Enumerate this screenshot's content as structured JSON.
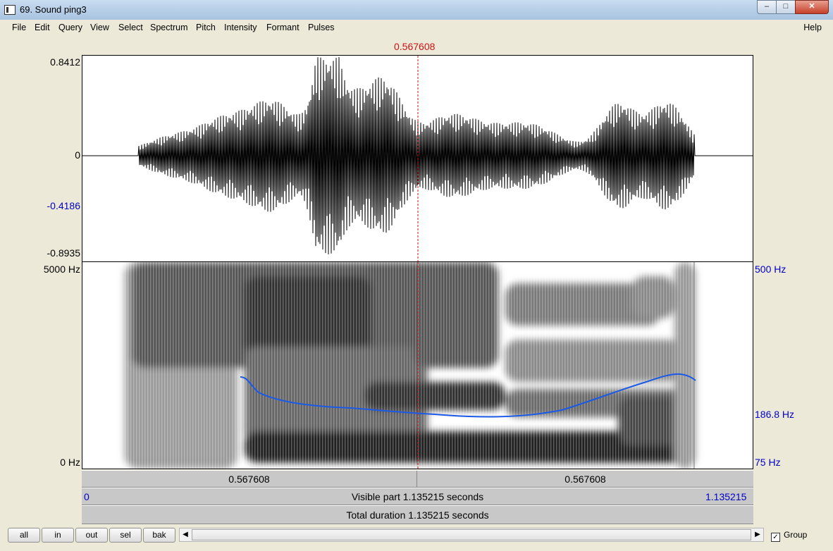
{
  "window": {
    "title": "69. Sound ping3",
    "min_glyph": "–",
    "max_glyph": "□",
    "close_glyph": "✕"
  },
  "menu": {
    "items": [
      "File",
      "Edit",
      "Query",
      "View",
      "Select",
      "Spectrum",
      "Pitch",
      "Intensity",
      "Formant",
      "Pulses"
    ],
    "help": "Help"
  },
  "editor": {
    "cursor_time": "0.567608",
    "waveform": {
      "ymax": "0.8412",
      "yzero": "0",
      "cursor_value": "-0.4186",
      "ymin": "-0.8935"
    },
    "spectrogram": {
      "freq_top": "5000 Hz",
      "freq_bottom": "0 Hz",
      "pitch_top": "500 Hz",
      "pitch_cursor": "186.8 Hz",
      "pitch_bottom": "75 Hz"
    },
    "time_bar": {
      "left_segment": "0.567608",
      "right_segment": "0.567608"
    },
    "visible_start": "0",
    "visible_end": "1.135215",
    "visible_part": "Visible part 1.135215 seconds",
    "total_duration": "Total duration 1.135215 seconds"
  },
  "bottom": {
    "buttons": [
      "all",
      "in",
      "out",
      "sel",
      "bak"
    ],
    "scroll_left": "◀",
    "scroll_right": "▶",
    "group_checked": "✓",
    "group_label": "Group"
  },
  "colors": {
    "cursor": "#cc1414",
    "pitch_curve": "#1a5ae6",
    "axis_blue": "#0000c8"
  }
}
